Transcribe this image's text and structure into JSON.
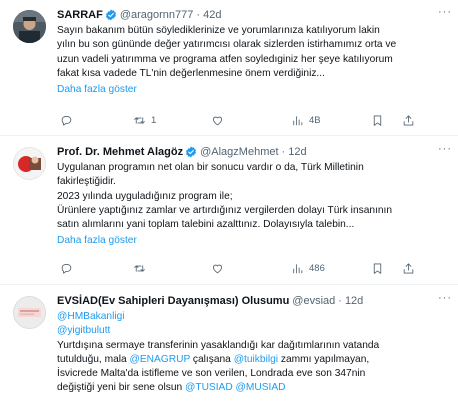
{
  "tweets": [
    {
      "name": "SARRAF",
      "handle": "@aragornn777",
      "dot": "·",
      "time": "42d",
      "lines": [
        "Sayın bakanım bütün söylediklerinize ve yorumlarınıza katılıyorum lakin",
        "yılın bu son gününde değer yatırımcısı olarak sizlerden istirhamımız orta ve",
        "uzun vadeli yatırımma ve programa atfen soyledıginiz her şeye katılıyorum",
        "fakat kısa vadede TL'nin değerlenmesine önem verdiğiniz..."
      ],
      "show_more": "Daha fazla göster",
      "counts": {
        "reply": "",
        "retweet": "1",
        "like": "",
        "views": "4B"
      }
    },
    {
      "name": "Prof. Dr. Mehmet Alagöz",
      "handle": "@AlagzMehmet",
      "dot": "·",
      "time": "12d",
      "lines": [
        "Uygulanan programın net olan bir sonucu vardır o da, Türk Milletinin",
        "fakirleştiğidir.",
        "2023 yılında uyguladığınız program ile;",
        "Ürünlere yaptığınız zamlar ve artırdığınız vergilerden dolayı Türk insanının",
        "satın alımlarını yani toplam talebini azalttınız. Dolayısıyla talebin..."
      ],
      "show_more": "Daha fazla göster",
      "counts": {
        "reply": "",
        "retweet": "",
        "like": "",
        "views": "486"
      }
    },
    {
      "name": "EVSİAD(Ev Sahipleri Dayanışması) Olusumu",
      "handle": "@evsiad",
      "dot": "·",
      "time": "12d",
      "mention1": "@HMBakanligi",
      "mention2": "@yigitbulutt",
      "line1": "Yurtdışına sermaye transferinin yasaklandığı kar dağıtımlarının vatanda",
      "line2": "tutulduğu, mala",
      "mention3": "@ENAGRUP",
      "line2b": "çalışana",
      "mention4": "@tuikbilgi",
      "line2c": "zammı yapılmayan,",
      "line3": "İsvicrede Malta'da istifleme ve son verilen, Londrada eve son 347nin",
      "line4": "değiştiği yeni bir sene olsun",
      "mention5": "@TUSIAD",
      "mention6": "@MUSIAD"
    }
  ],
  "more_glyph": "···",
  "colors": {
    "accent": "#1d9bf0",
    "secondary": "#536471",
    "text": "#0f1419",
    "verified": "#1d9bf0"
  }
}
